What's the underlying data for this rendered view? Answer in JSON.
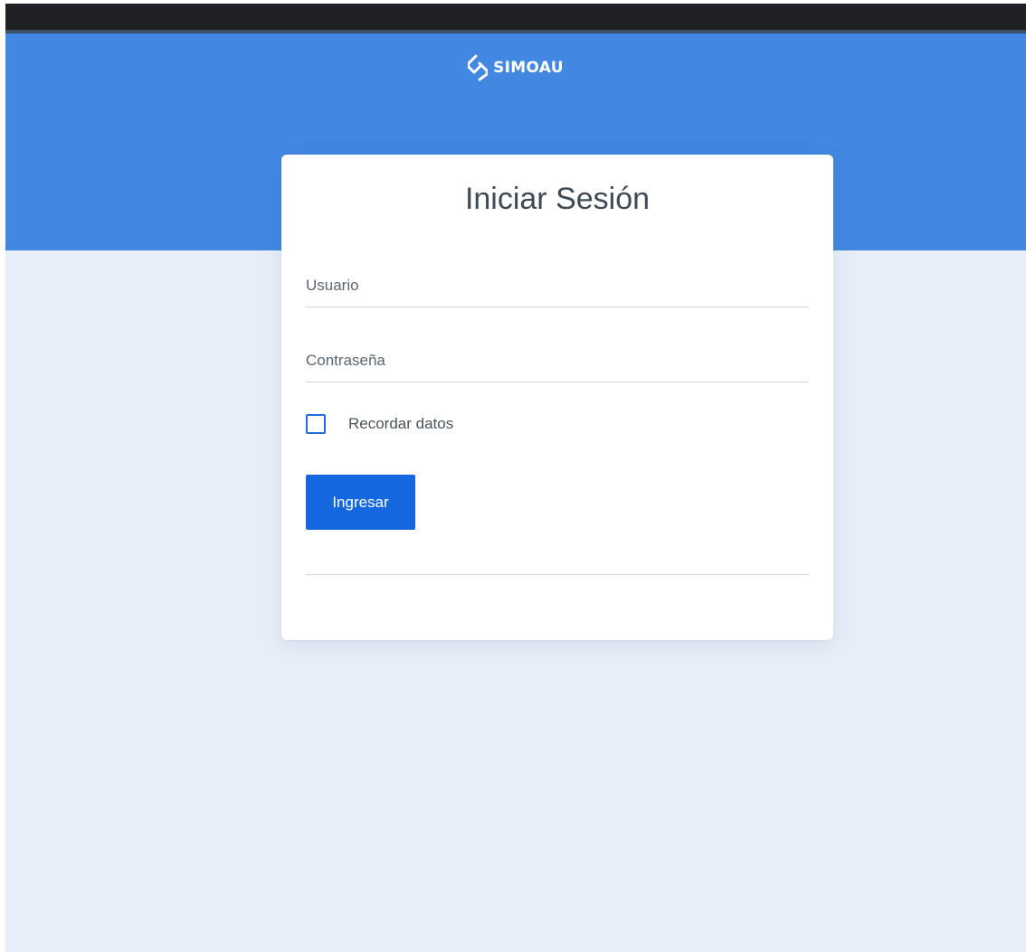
{
  "brand": {
    "name": "SIMOAU",
    "icon": "simoau-logo-icon"
  },
  "login": {
    "title": "Iniciar Sesión",
    "username": {
      "placeholder": "Usuario",
      "value": ""
    },
    "password": {
      "placeholder": "Contraseña",
      "value": ""
    },
    "remember_label": "Recordar datos",
    "remember_checked": false,
    "submit_label": "Ingresar"
  },
  "colors": {
    "header_bg": "#4287e1",
    "page_bg": "#e7eef9",
    "primary_button": "#1467df",
    "checkbox_border": "#1f6fd6",
    "title_text": "#3e4a55"
  }
}
